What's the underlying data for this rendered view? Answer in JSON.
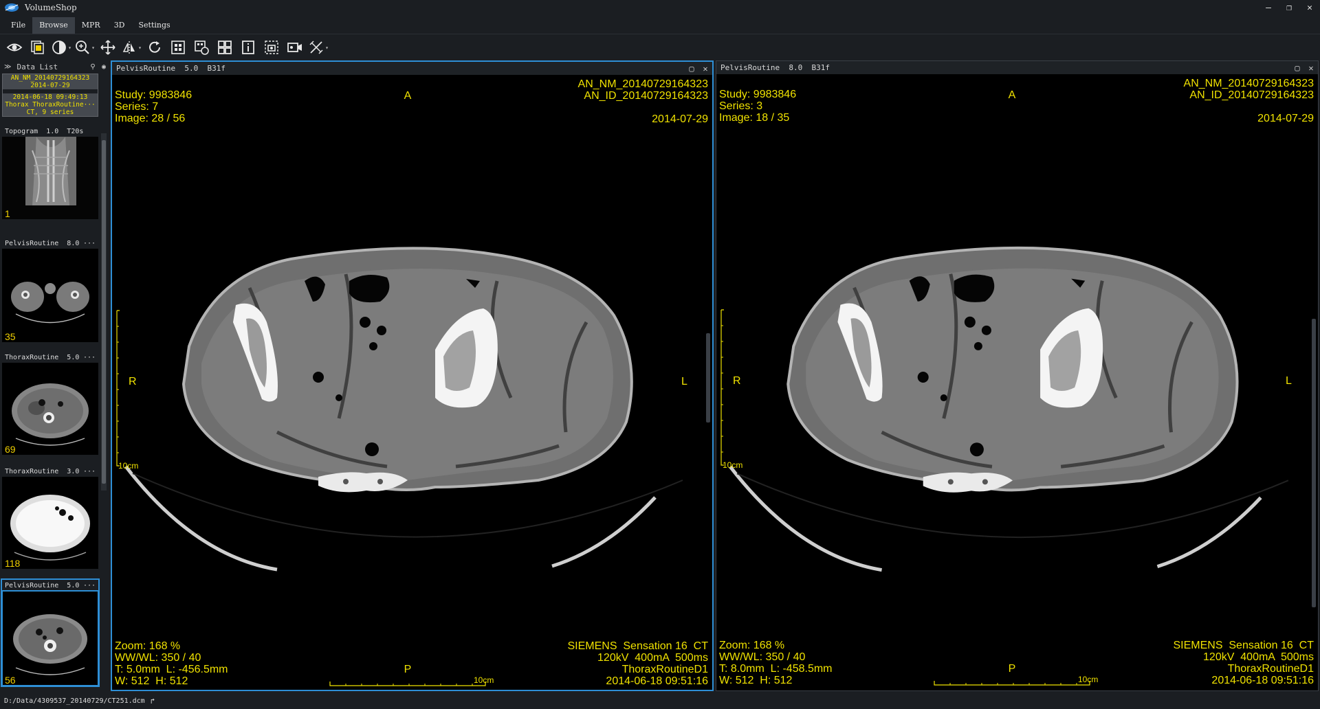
{
  "app": {
    "title": "VolumeShop"
  },
  "window_controls": {
    "minimize": "—",
    "restore": "❐",
    "close": "✕"
  },
  "menu": [
    {
      "label": "File"
    },
    {
      "label": "Browse",
      "active": true
    },
    {
      "label": "MPR"
    },
    {
      "label": "3D"
    },
    {
      "label": "Settings"
    }
  ],
  "toolbar": {
    "icons": [
      "eye-icon",
      "stack-icon",
      "contrast-icon",
      "zoom-icon",
      "pan-icon",
      "flip-icon",
      "rotate-icon",
      "layout-grid-icon",
      "compare-icon",
      "quad-layout-icon",
      "info-icon",
      "snapshot-icon",
      "video-icon",
      "measure-icon"
    ]
  },
  "data_list": {
    "header": "Data List",
    "study": {
      "name": "AN_NM_20140729164323",
      "date": "2014-07-29",
      "time": "2014-06-18  09:49:13",
      "desc": "Thorax ThoraxRoutine···",
      "count": "CT, 9 series"
    },
    "series": [
      {
        "label": "Topogram  1.0  T20s",
        "count": "1",
        "dots": ""
      },
      {
        "label": "PelvisRoutine  8.0",
        "count": "35",
        "dots": "···"
      },
      {
        "label": "ThoraxRoutine  5.0",
        "count": "69",
        "dots": "···"
      },
      {
        "label": "ThoraxRoutine  3.0",
        "count": "118",
        "dots": "···"
      },
      {
        "label": "PelvisRoutine  5.0",
        "count": "56",
        "dots": "···"
      }
    ]
  },
  "viewports": [
    {
      "header": "PelvisRoutine  5.0  B31f",
      "study": "Study: 9983846",
      "series": "Series: 7",
      "image": "Image: 28 / 56",
      "an_nm": "AN_NM_20140729164323",
      "an_id": "AN_ID_20140729164323",
      "date": "2014-07-29",
      "orient_top": "A",
      "orient_left": "R",
      "orient_right": "L",
      "orient_bottom": "P",
      "zoom": "Zoom: 168 %",
      "wwwl": "WW/WL: 350 / 40",
      "thickness": "T: 5.0mm  L: -456.5mm",
      "dims": "W: 512  H: 512",
      "scanner": "SIEMENS  Sensation 16  CT",
      "params": "120kV  400mA  500ms",
      "protocol": "ThoraxRoutineD1",
      "acq_time": "2014-06-18 09:51:16",
      "scale_v": "10cm",
      "scale_h": "10cm"
    },
    {
      "header": "PelvisRoutine  8.0  B31f",
      "study": "Study: 9983846",
      "series": "Series: 3",
      "image": "Image: 18 / 35",
      "an_nm": "AN_NM_20140729164323",
      "an_id": "AN_ID_20140729164323",
      "date": "2014-07-29",
      "orient_top": "A",
      "orient_left": "R",
      "orient_right": "L",
      "orient_bottom": "P",
      "zoom": "Zoom: 168 %",
      "wwwl": "WW/WL: 350 / 40",
      "thickness": "T: 8.0mm  L: -458.5mm",
      "dims": "W: 512  H: 512",
      "scanner": "SIEMENS  Sensation 16  CT",
      "params": "120kV  400mA  500ms",
      "protocol": "ThoraxRoutineD1",
      "acq_time": "2014-06-18 09:51:16",
      "scale_v": "10cm",
      "scale_h": "10cm"
    }
  ],
  "status": {
    "path": "D:/Data/4309537_20140729/CT251.dcm",
    "arrow": "↱"
  },
  "colors": {
    "accent": "#2e8fd6",
    "overlay_text": "#f0e200",
    "background": "#1b1e22"
  }
}
